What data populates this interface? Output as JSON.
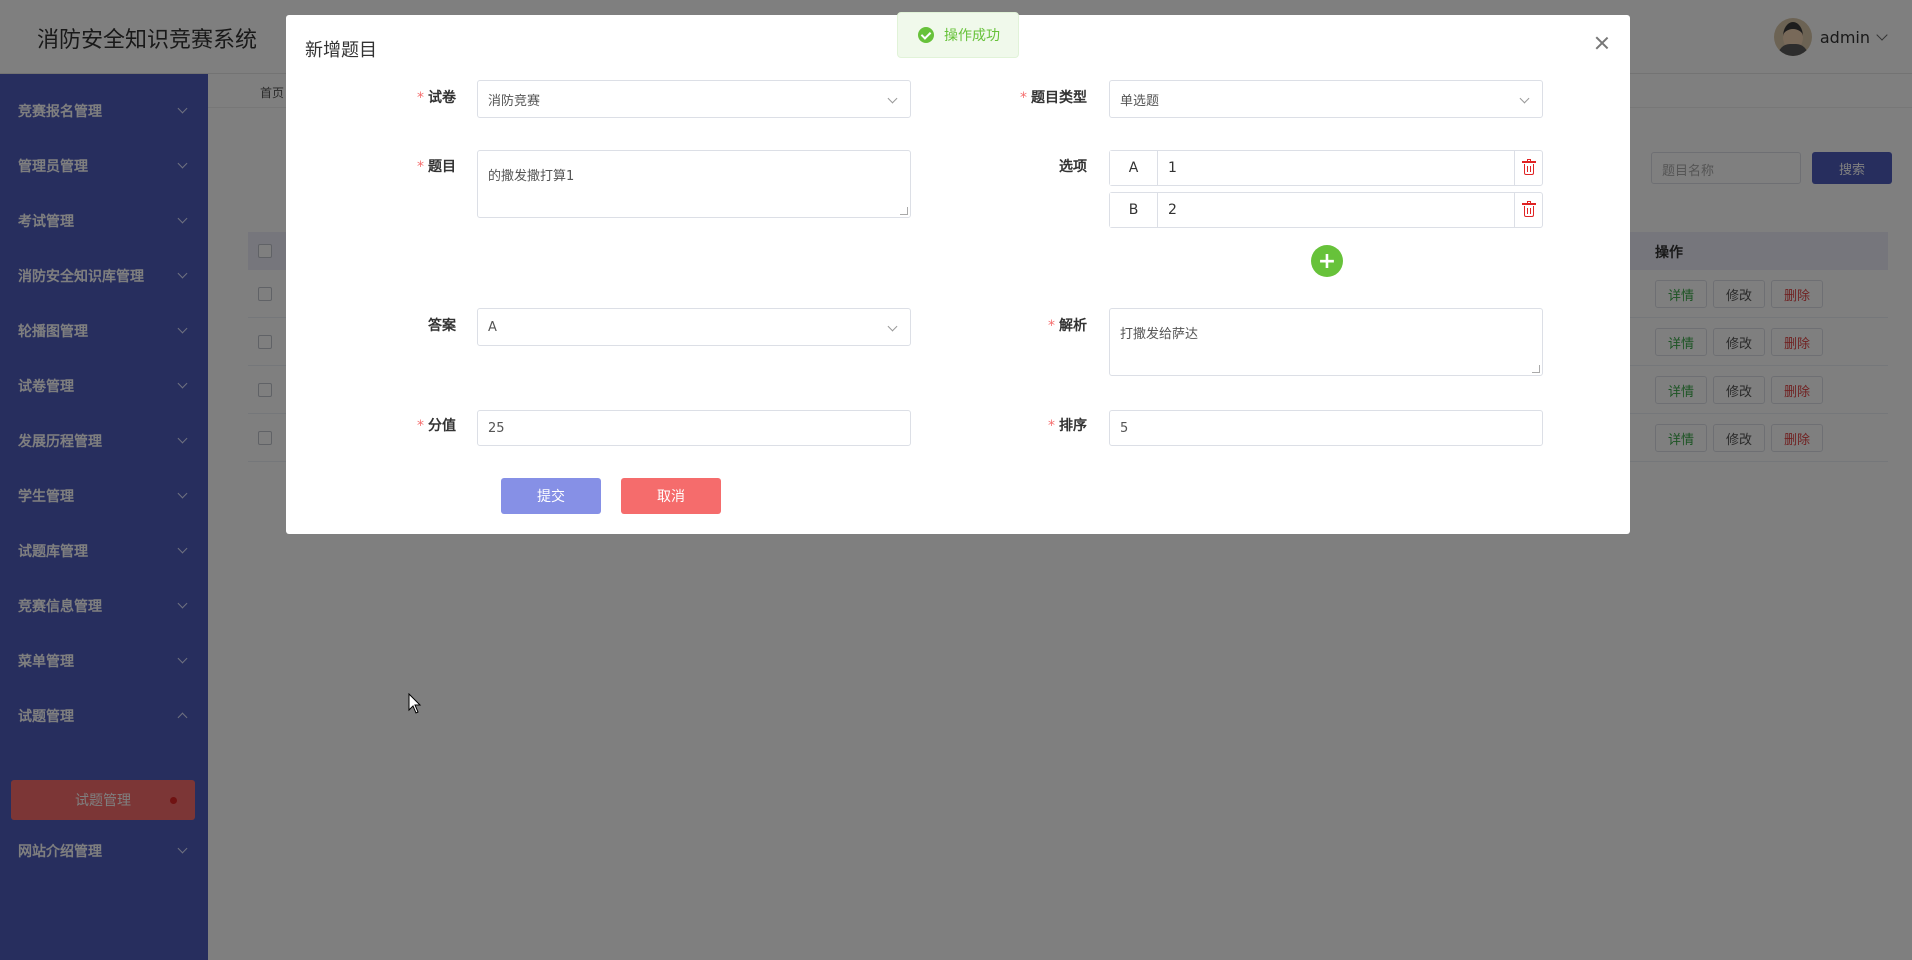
{
  "app": {
    "title": "消防安全知识竞赛系统"
  },
  "user": {
    "name": "admin"
  },
  "sidebar": {
    "items": [
      {
        "label": "竞赛报名管理"
      },
      {
        "label": "管理员管理"
      },
      {
        "label": "考试管理"
      },
      {
        "label": "消防安全知识库管理"
      },
      {
        "label": "轮播图管理"
      },
      {
        "label": "试卷管理"
      },
      {
        "label": "发展历程管理"
      },
      {
        "label": "学生管理"
      },
      {
        "label": "试题库管理"
      },
      {
        "label": "竞赛信息管理"
      },
      {
        "label": "菜单管理"
      },
      {
        "label": "试题管理"
      },
      {
        "label": "网站介绍管理"
      }
    ],
    "active_sub": {
      "label": "试题管理"
    }
  },
  "content": {
    "breadcrumb": "首页",
    "search": {
      "placeholder": "题目名称",
      "button": "搜索"
    },
    "table": {
      "op_header": "操作",
      "row_buttons": {
        "detail": "详情",
        "edit": "修改",
        "delete": "删除"
      }
    }
  },
  "toast": {
    "message": "操作成功"
  },
  "modal": {
    "title": "新增题目",
    "fields": {
      "paper": {
        "label": "试卷",
        "value": "消防竞赛"
      },
      "type": {
        "label": "题目类型",
        "value": "单选题"
      },
      "question": {
        "label": "题目",
        "value": "的撒发撒打算1"
      },
      "options": {
        "label": "选项",
        "items": [
          {
            "key": "A",
            "value": "1"
          },
          {
            "key": "B",
            "value": "2"
          }
        ]
      },
      "answer": {
        "label": "答案",
        "value": "A"
      },
      "analysis": {
        "label": "解析",
        "value": "打撒发给萨达"
      },
      "score": {
        "label": "分值",
        "value": "25"
      },
      "order": {
        "label": "排序",
        "value": "5"
      }
    },
    "buttons": {
      "submit": "提交",
      "cancel": "取消"
    }
  }
}
